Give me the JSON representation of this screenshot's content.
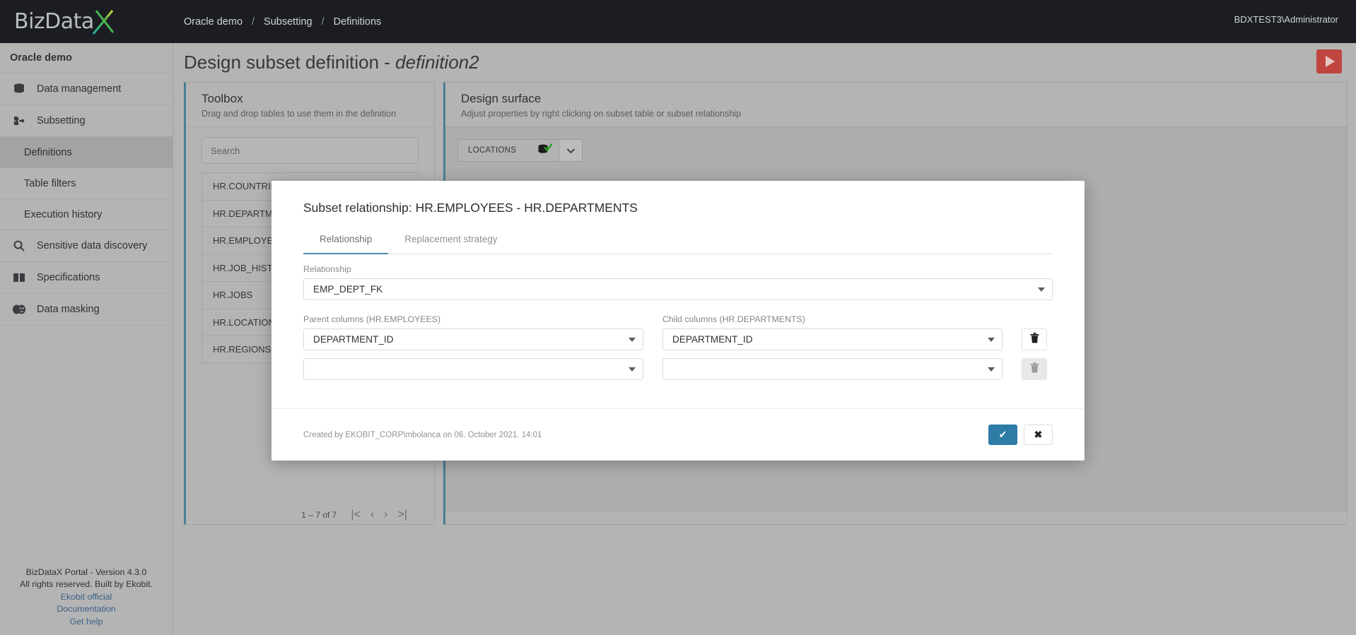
{
  "app": {
    "logo_text": "BizData",
    "logo_accent": "#7cc242",
    "user": "BDXTEST3\\Administrator"
  },
  "breadcrumb": [
    "Oracle demo",
    "Subsetting",
    "Definitions"
  ],
  "sidebar": {
    "title": "Oracle demo",
    "items": [
      {
        "label": "Data management",
        "icon": "database-icon"
      },
      {
        "label": "Subsetting",
        "icon": "puzzle-icon"
      },
      {
        "label": "Sensitive data discovery",
        "icon": "search-icon"
      },
      {
        "label": "Specifications",
        "icon": "book-icon"
      },
      {
        "label": "Data masking",
        "icon": "masks-icon"
      }
    ],
    "subitems": [
      {
        "label": "Definitions",
        "active": true
      },
      {
        "label": "Table filters",
        "active": false
      },
      {
        "label": "Execution history",
        "active": false
      }
    ],
    "footer": {
      "version": "BizDataX Portal - Version 4.3.0",
      "rights": "All rights reserved. Built by Ekobit.",
      "links": [
        "Ekobit official",
        "Documentation",
        "Get help"
      ]
    }
  },
  "page": {
    "title_prefix": "Design subset definition - ",
    "title_name": "definition2",
    "run_button": "run-icon"
  },
  "toolbox": {
    "heading": "Toolbox",
    "subheading": "Drag and drop tables to use them in the definition",
    "search_placeholder": "Search",
    "tables": [
      "HR.COUNTRIES",
      "HR.DEPARTMENTS",
      "HR.EMPLOYEES",
      "HR.JOB_HISTORY",
      "HR.JOBS",
      "HR.LOCATIONS",
      "HR.REGIONS"
    ],
    "pager": {
      "range": "1 – 7 of 7",
      "first": "|<",
      "prev": "‹",
      "next": "›",
      "last": ">|"
    }
  },
  "design_surface": {
    "heading": "Design surface",
    "subheading": "Adjust properties by right clicking on subset table or subset relationship",
    "nodes": [
      {
        "label": "LOCATIONS",
        "status": "checked"
      }
    ]
  },
  "modal": {
    "title": "Subset relationship: HR.EMPLOYEES - HR.DEPARTMENTS",
    "tabs": [
      {
        "label": "Relationship",
        "active": true
      },
      {
        "label": "Replacement strategy",
        "active": false
      }
    ],
    "relationship": {
      "label": "Relationship",
      "value": "EMP_DEPT_FK"
    },
    "parent": {
      "label": "Parent columns (HR.EMPLOYEES)",
      "values": [
        "DEPARTMENT_ID",
        ""
      ]
    },
    "child": {
      "label": "Child columns (HR.DEPARTMENTS)",
      "values": [
        "DEPARTMENT_ID",
        ""
      ]
    },
    "delete_buttons": [
      "delete-icon",
      "delete-icon"
    ],
    "created_by": "Created by EKOBIT_CORP\\mbolanca on 06. October 2021. 14:01",
    "ok_label": "✔",
    "cancel_label": "✖",
    "accent": "#2e7ba6"
  }
}
